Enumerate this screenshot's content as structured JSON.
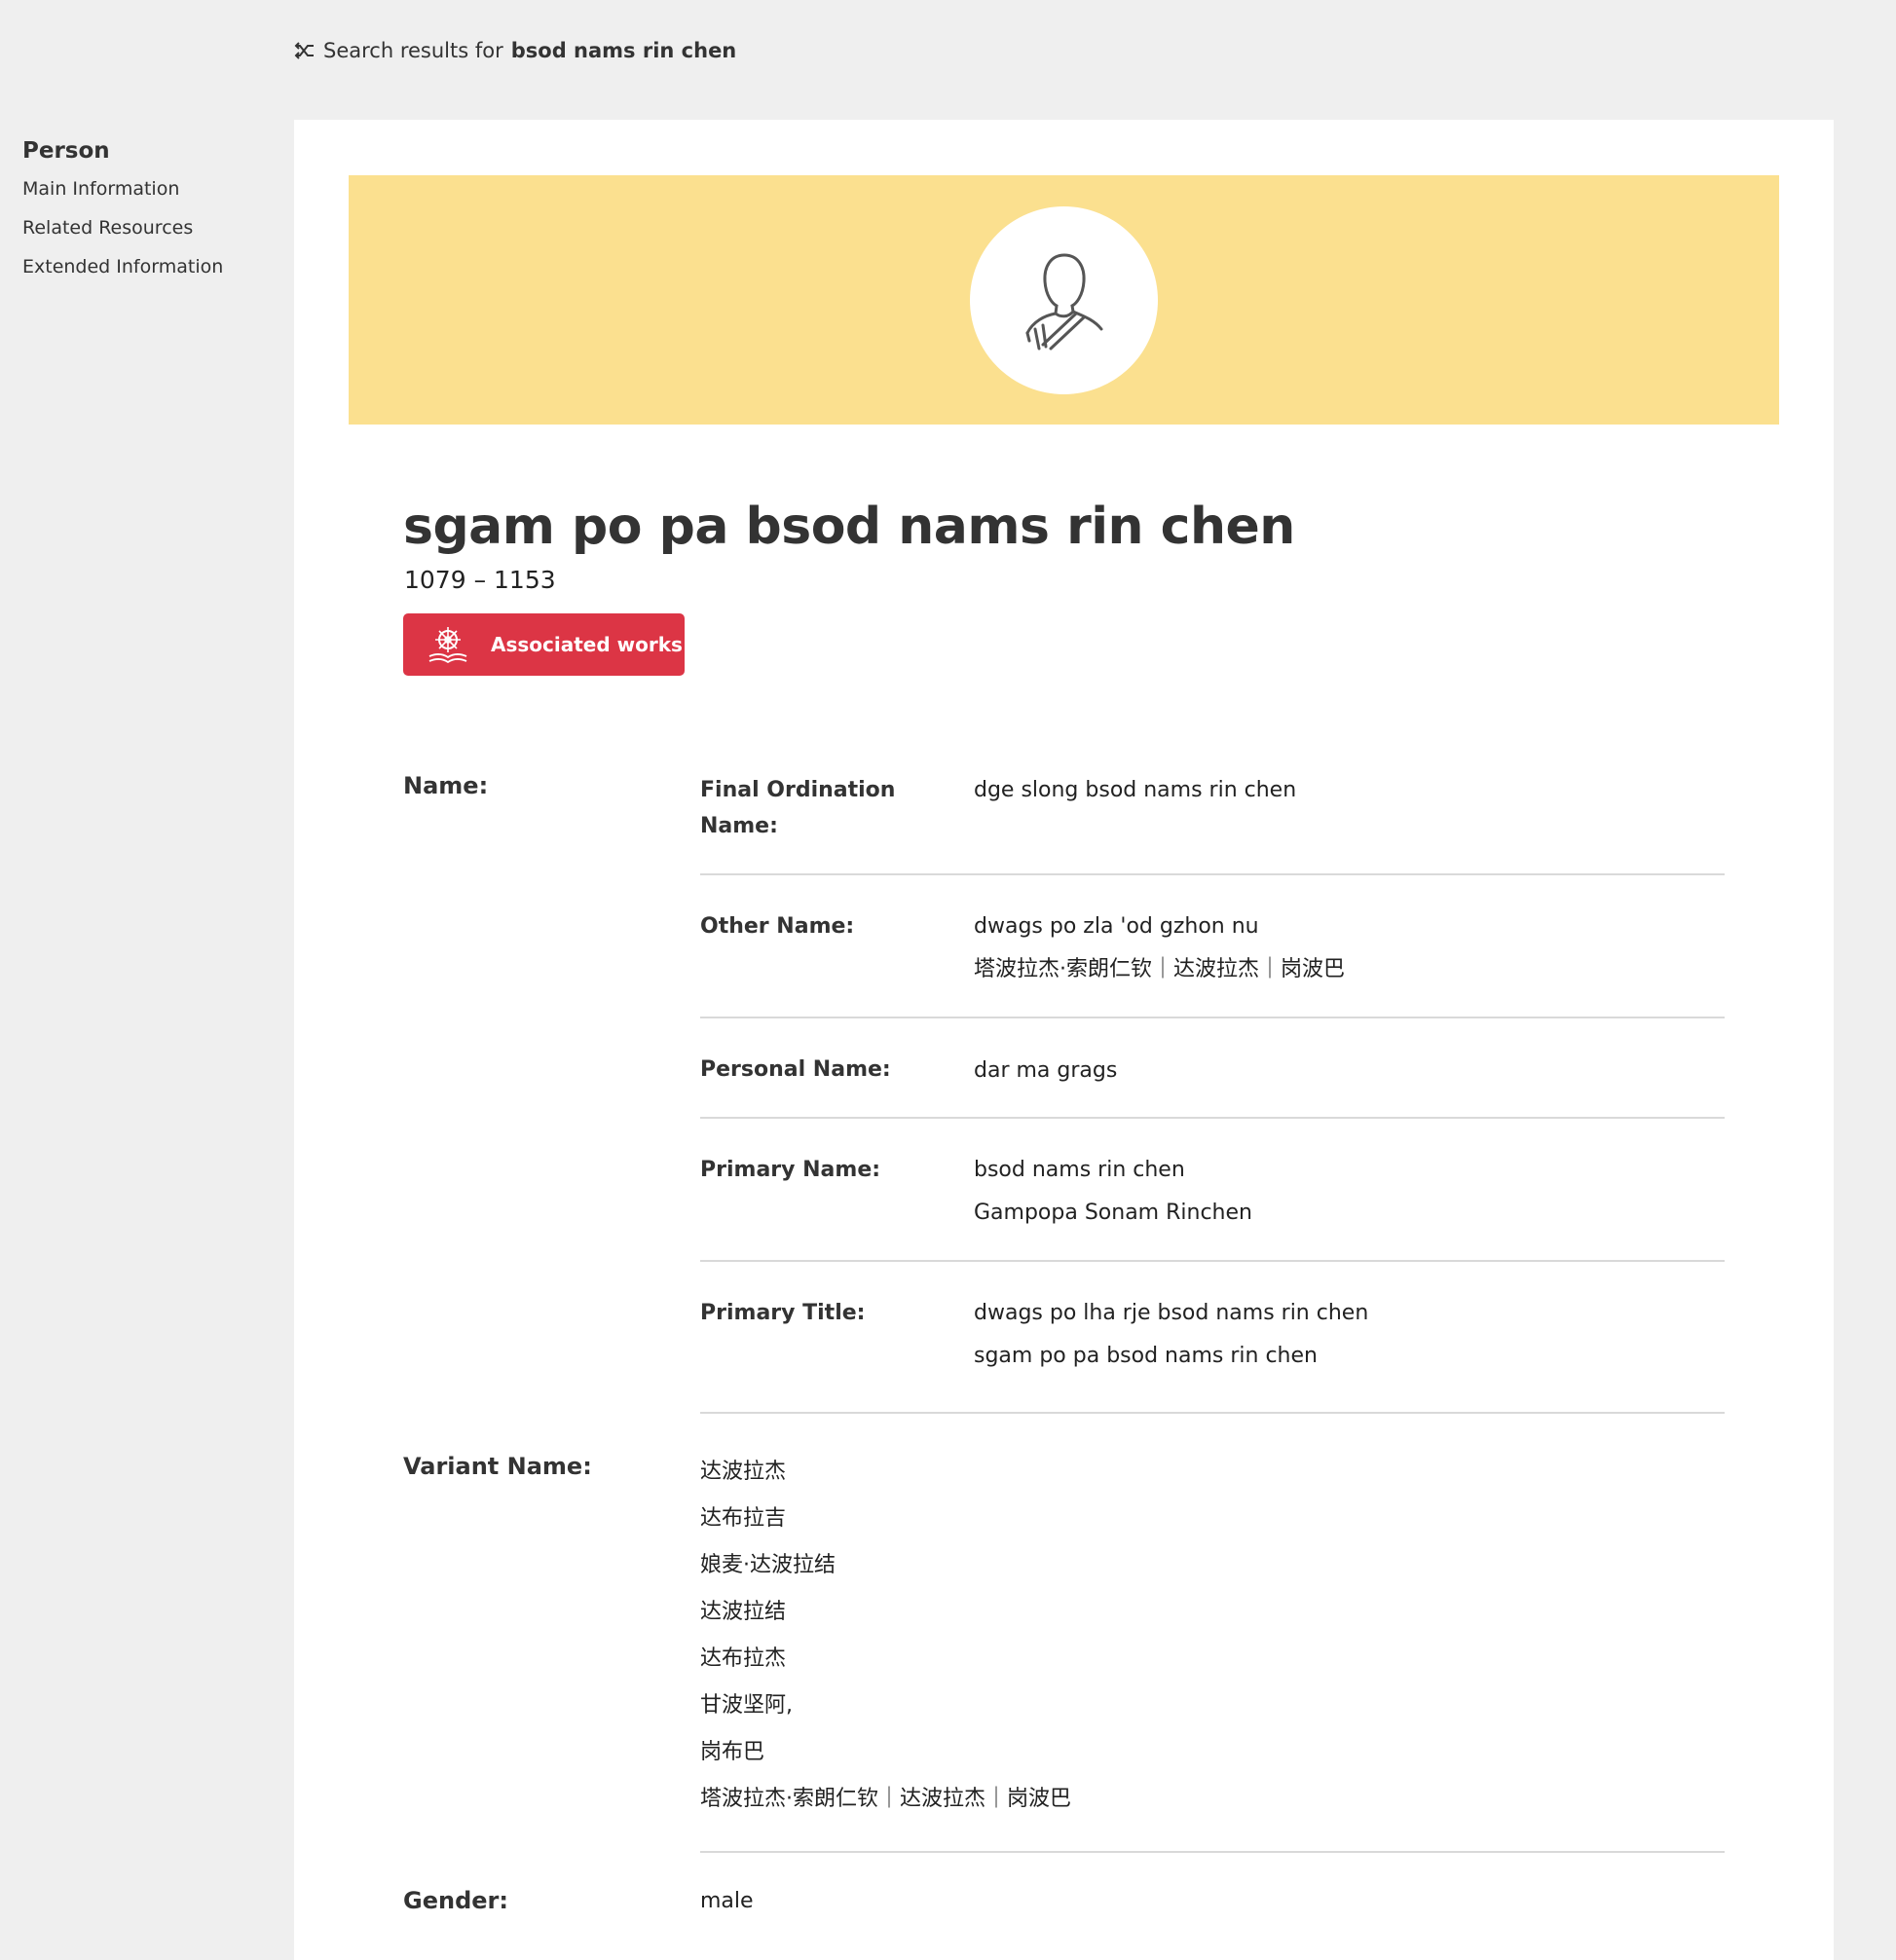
{
  "search": {
    "prefix": "Search results for",
    "query": "bsod nams rin chen",
    "icon": "shuffle-back-icon"
  },
  "sidebar": {
    "heading": "Person",
    "items": [
      {
        "label": "Main Information"
      },
      {
        "label": "Related Resources"
      },
      {
        "label": "Extended Information"
      }
    ]
  },
  "banner": {
    "color": "#fbe08f",
    "icon": "monk-person-icon"
  },
  "person": {
    "title": "sgam po pa bsod nams rin chen",
    "dates": "1079 – 1153",
    "associated_works_label": "Associated works",
    "associated_works_color": "#dc3545",
    "associated_works_icon": "dharma-wheel-book-icon"
  },
  "fields": {
    "name_label": "Name:",
    "name_entries": [
      {
        "label": "Final Ordination Name:",
        "values": [
          "dge slong bsod nams rin chen"
        ]
      },
      {
        "label": "Other Name:",
        "values": [
          "dwags po zla 'od gzhon nu",
          "塔波拉杰·索朗仁钦｜达波拉杰｜岗波巴"
        ]
      },
      {
        "label": "Personal Name:",
        "values": [
          "dar ma grags"
        ]
      },
      {
        "label": "Primary Name:",
        "values": [
          "bsod nams rin chen",
          "Gampopa Sonam Rinchen"
        ]
      },
      {
        "label": "Primary Title:",
        "values": [
          "dwags po lha rje bsod nams rin chen",
          "sgam po pa bsod nams rin chen"
        ]
      }
    ],
    "variant_label": "Variant Name:",
    "variant_values": [
      "达波拉杰",
      "达布拉吉",
      "娘麦·达波拉结",
      "达波拉结",
      "达布拉杰",
      "甘波坚阿,",
      "岗布巴",
      "塔波拉杰·索朗仁钦｜达波拉杰｜岗波巴"
    ],
    "gender_label": "Gender:",
    "gender_value": "male"
  }
}
